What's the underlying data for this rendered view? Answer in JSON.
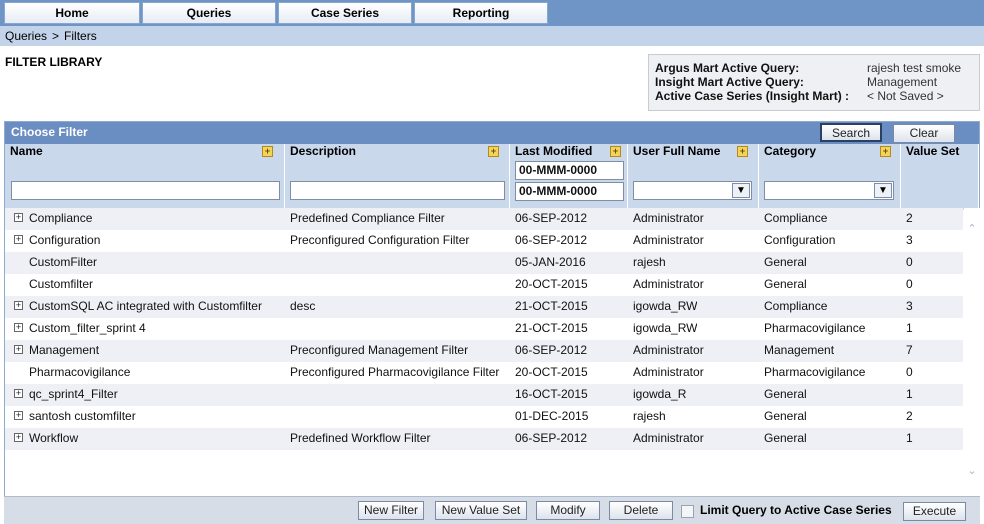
{
  "nav": {
    "tabs": [
      "Home",
      "Queries",
      "Case Series",
      "Reporting"
    ]
  },
  "breadcrumb": {
    "parent": "Queries",
    "separator": ">",
    "current": "Filters"
  },
  "page_title": "FILTER LIBRARY",
  "active": {
    "argus_label": "Argus Mart Active Query:",
    "argus_value": "rajesh test smoke",
    "insight_label": "Insight Mart Active Query:",
    "insight_value": "Management",
    "series_label": "Active Case Series (Insight Mart) :",
    "series_value": "< Not Saved >"
  },
  "panel": {
    "title": "Choose Filter",
    "search_label": "Search",
    "clear_label": "Clear",
    "columns": {
      "name": "Name",
      "description": "Description",
      "last_modified": "Last Modified",
      "user": "User Full Name",
      "category": "Category",
      "value_set": "Value Set"
    },
    "sort_icon": "+",
    "date_from": "00-MMM-0000",
    "date_to": "00-MMM-0000"
  },
  "rows": [
    {
      "expand": true,
      "name": "Compliance",
      "description": "Predefined Compliance Filter",
      "modified": "06-SEP-2012",
      "user": "Administrator",
      "category": "Compliance",
      "value_set": "2"
    },
    {
      "expand": true,
      "name": "Configuration",
      "description": "Preconfigured Configuration Filter",
      "modified": "06-SEP-2012",
      "user": "Administrator",
      "category": "Configuration",
      "value_set": "3"
    },
    {
      "expand": false,
      "name": "CustomFilter",
      "description": "",
      "modified": "05-JAN-2016",
      "user": "rajesh",
      "category": "General",
      "value_set": "0"
    },
    {
      "expand": false,
      "name": "Customfilter",
      "description": "",
      "modified": "20-OCT-2015",
      "user": "Administrator",
      "category": "General",
      "value_set": "0"
    },
    {
      "expand": true,
      "name": "CustomSQL AC integrated with Customfilter",
      "description": "desc",
      "modified": "21-OCT-2015",
      "user": "igowda_RW",
      "category": "Compliance",
      "value_set": "3"
    },
    {
      "expand": true,
      "name": "Custom_filter_sprint 4",
      "description": "",
      "modified": "21-OCT-2015",
      "user": "igowda_RW",
      "category": "Pharmacovigilance",
      "value_set": "1"
    },
    {
      "expand": true,
      "name": "Management",
      "description": "Preconfigured Management Filter",
      "modified": "06-SEP-2012",
      "user": "Administrator",
      "category": "Management",
      "value_set": "7"
    },
    {
      "expand": false,
      "name": "Pharmacovigilance",
      "description": "Preconfigured Pharmacovigilance Filter",
      "modified": "20-OCT-2015",
      "user": "Administrator",
      "category": "Pharmacovigilance",
      "value_set": "0"
    },
    {
      "expand": true,
      "name": "qc_sprint4_Filter",
      "description": "",
      "modified": "16-OCT-2015",
      "user": "igowda_R",
      "category": "General",
      "value_set": "1"
    },
    {
      "expand": true,
      "name": "santosh customfilter",
      "description": "",
      "modified": "01-DEC-2015",
      "user": "rajesh",
      "category": "General",
      "value_set": "2"
    },
    {
      "expand": true,
      "name": "Workflow",
      "description": "Predefined Workflow Filter",
      "modified": "06-SEP-2012",
      "user": "Administrator",
      "category": "General",
      "value_set": "1"
    }
  ],
  "footer": {
    "new_filter": "New Filter",
    "new_value_set": "New Value Set",
    "modify": "Modify",
    "delete": "Delete",
    "limit_label": "Limit Query to Active Case Series",
    "execute": "Execute"
  }
}
